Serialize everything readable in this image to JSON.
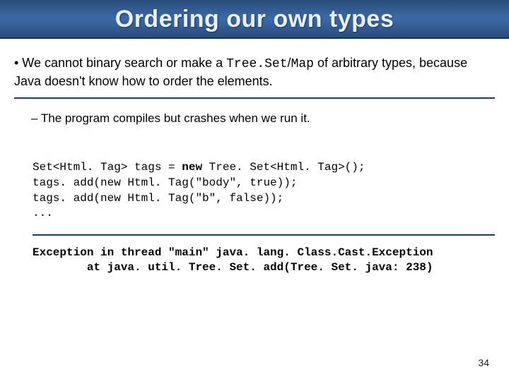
{
  "header": {
    "title": "Ordering our own types"
  },
  "bullet": {
    "pre": "• We cannot binary search or make a ",
    "code": "Tree.Set",
    "mid": "/",
    "code2": "Map",
    "post": " of arbitrary types, because Java doesn't know how to order the elements."
  },
  "subbullet": "– The program compiles but crashes when we run it.",
  "code": {
    "l1a": "Set<Html. Tag> tags = ",
    "l1kw": "new",
    "l1b": " Tree. Set<Html. Tag>();",
    "l2": "tags. add(new Html. Tag(\"body\", true));",
    "l3": "tags. add(new Html. Tag(\"b\", false));",
    "l4": "..."
  },
  "error": {
    "l1": "Exception in thread \"main\" java. lang. Class.Cast.Exception",
    "l2": "        at java. util. Tree. Set. add(Tree. Set. java: 238)"
  },
  "pagenum": "34"
}
